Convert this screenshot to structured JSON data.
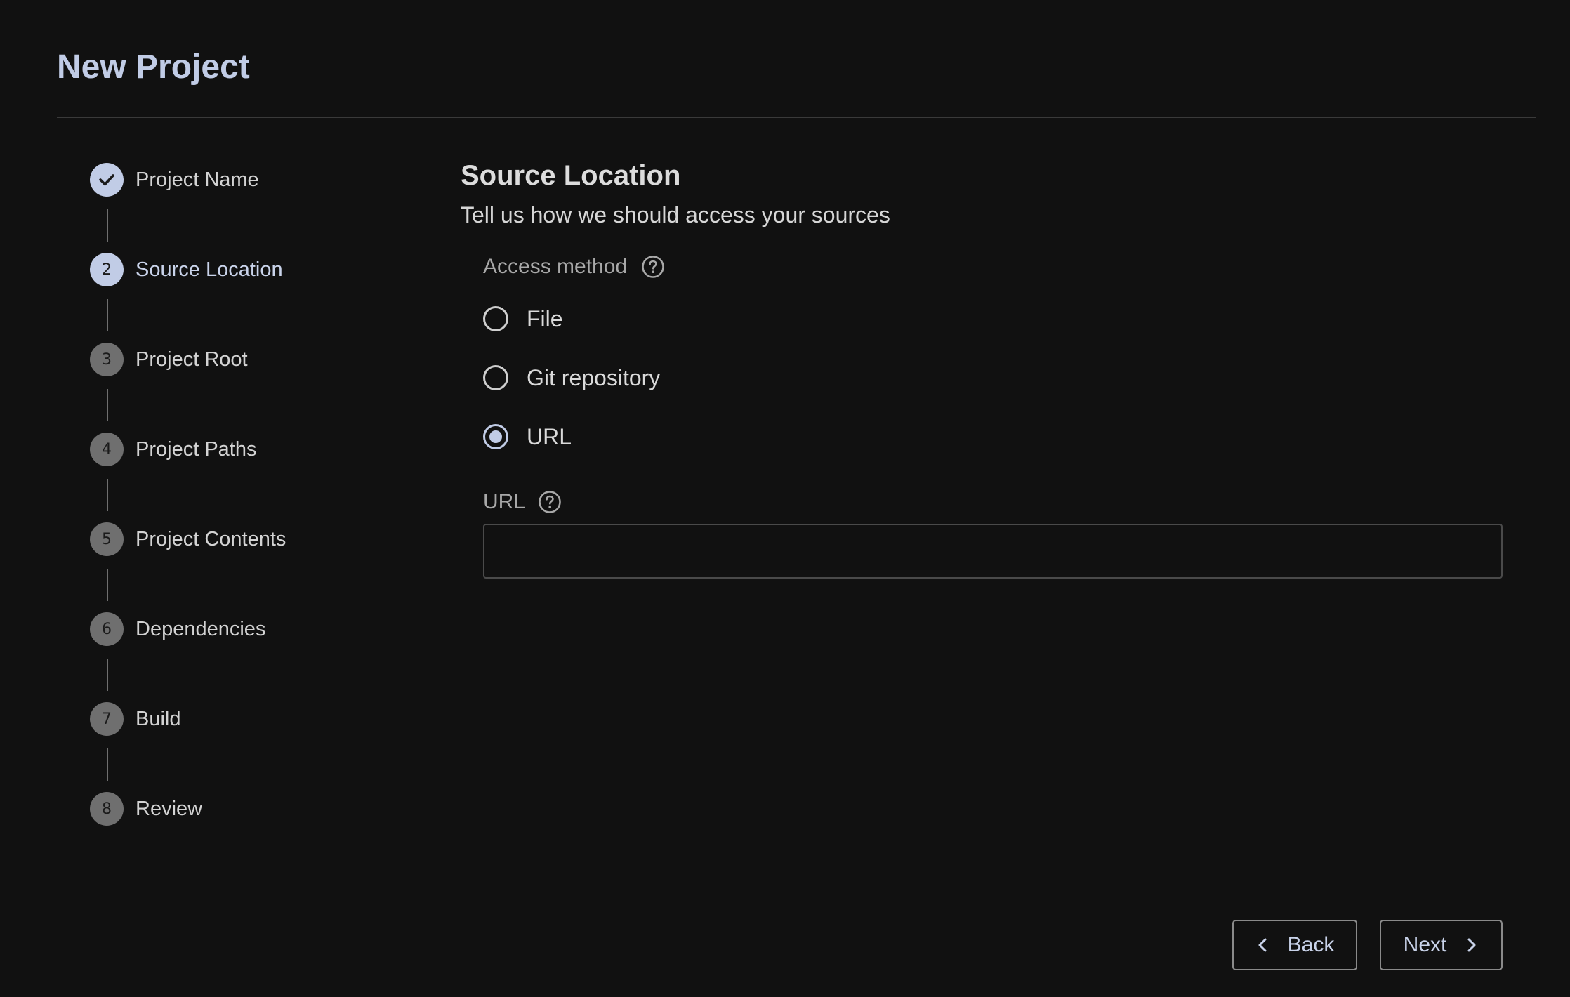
{
  "header": {
    "title": "New Project"
  },
  "stepper": {
    "steps": [
      {
        "number": "",
        "label": "Project Name",
        "state": "done",
        "icon": "check-icon"
      },
      {
        "number": "2",
        "label": "Source Location",
        "state": "current"
      },
      {
        "number": "3",
        "label": "Project Root",
        "state": "pending"
      },
      {
        "number": "4",
        "label": "Project Paths",
        "state": "pending"
      },
      {
        "number": "5",
        "label": "Project Contents",
        "state": "pending"
      },
      {
        "number": "6",
        "label": "Dependencies",
        "state": "pending"
      },
      {
        "number": "7",
        "label": "Build",
        "state": "pending"
      },
      {
        "number": "8",
        "label": "Review",
        "state": "pending"
      }
    ]
  },
  "content": {
    "title": "Source Location",
    "subtitle": "Tell us how we should access your sources",
    "access_method": {
      "label": "Access method",
      "help_icon": "question-circle-icon",
      "options": [
        {
          "label": "File",
          "selected": false
        },
        {
          "label": "Git repository",
          "selected": false
        },
        {
          "label": "URL",
          "selected": true
        }
      ]
    },
    "url_field": {
      "label": "URL",
      "help_icon": "question-circle-icon",
      "value": "",
      "placeholder": ""
    }
  },
  "footer": {
    "back_label": "Back",
    "back_icon": "chevron-left-icon",
    "next_label": "Next",
    "next_icon": "chevron-right-icon"
  },
  "colors": {
    "background": "#111111",
    "accent": "#c1cce6",
    "pending_step": "#6f6f6f",
    "divider": "#3a3a3a"
  }
}
